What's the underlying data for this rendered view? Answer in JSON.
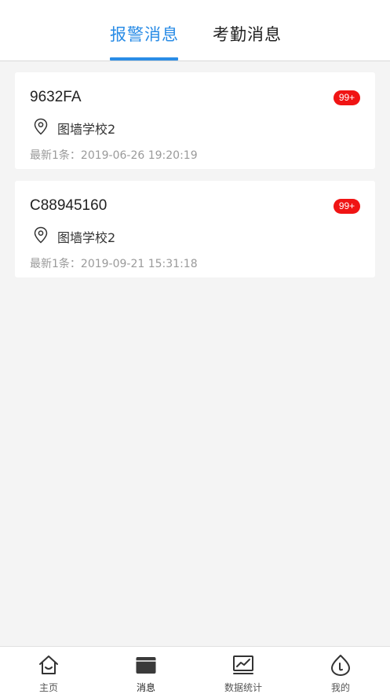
{
  "header": {
    "tabs": [
      {
        "label": "报警消息",
        "active": true
      },
      {
        "label": "考勤消息",
        "active": false
      }
    ]
  },
  "colors": {
    "accent": "#2a8ce6",
    "badge": "#f01414"
  },
  "messages": [
    {
      "device": "9632FA",
      "badge": "99+",
      "location": "图墙学校2",
      "latest": "最新1条：2019-06-26 19:20:19"
    },
    {
      "device": "C88945160",
      "badge": "99+",
      "location": "图墙学校2",
      "latest": "最新1条：2019-09-21 15:31:18"
    }
  ],
  "tabbar": {
    "items": [
      {
        "label": "主页",
        "icon": "home-icon"
      },
      {
        "label": "消息",
        "icon": "message-icon",
        "active": true
      },
      {
        "label": "数据统计",
        "icon": "chart-icon"
      },
      {
        "label": "我的",
        "icon": "profile-icon"
      }
    ]
  }
}
